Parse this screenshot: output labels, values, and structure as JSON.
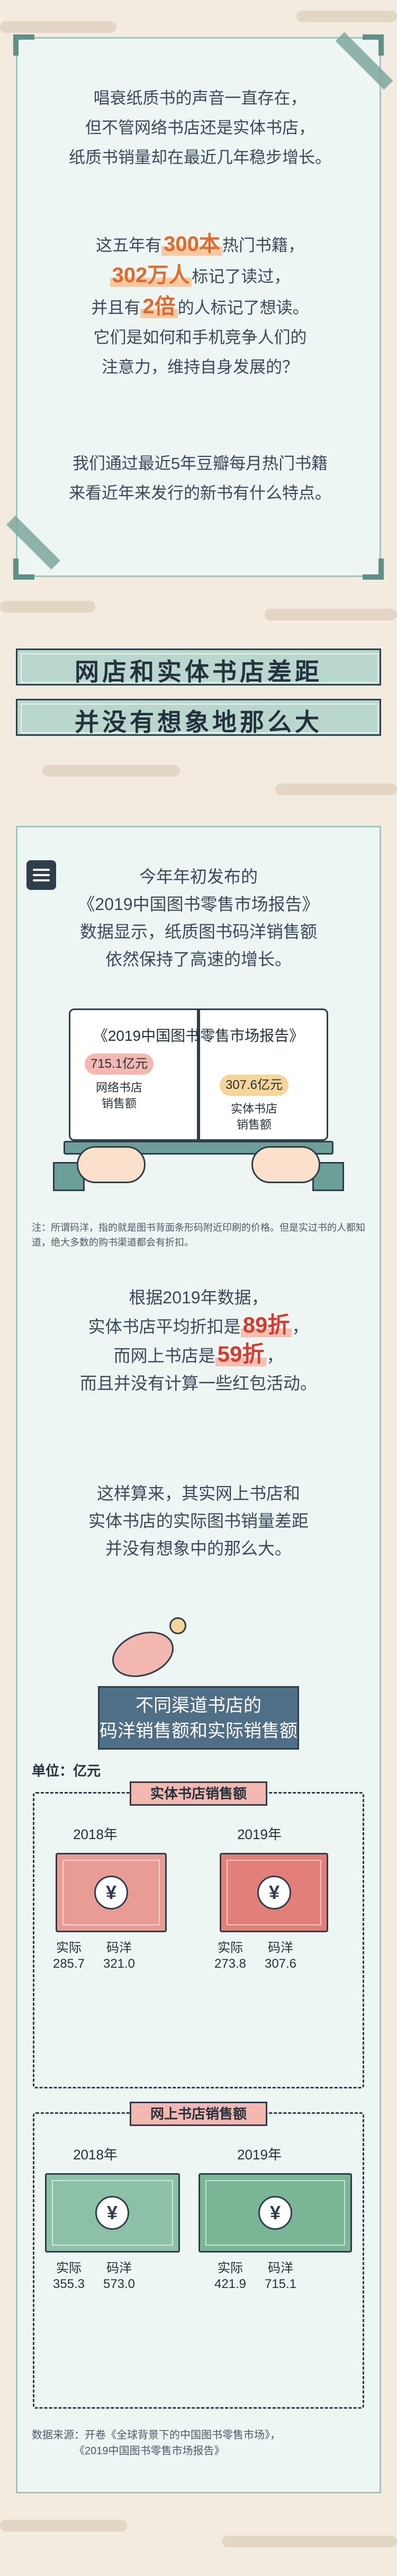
{
  "intro": {
    "line1": "唱衰纸质书的声音一直存在，",
    "line2": "但不管网络书店还是实体书店，",
    "line3": "纸质书销量却在最近几年稳步增长。",
    "stat1_pre": "这五年有",
    "stat1_hl": "300本",
    "stat1_post": "热门书籍，",
    "stat2_hl": "302万人",
    "stat2_post": "标记了读过，",
    "stat3_pre": "并且有",
    "stat3_hl": "2倍",
    "stat3_post": "的人标记了想读。",
    "q1": "它们是如何和手机竞争人们的",
    "q2": "注意力，维持自身发展的？",
    "p3_1": "我们通过最近5年豆瓣每月热门书籍",
    "p3_2": "来看近年来发行的新书有什么特点。"
  },
  "section_title": {
    "line1": "网店和实体书店差距",
    "line2": "并没有想象地那么大"
  },
  "report": {
    "l1": "今年年初发布的",
    "l2": "《2019中国图书零售市场报告》",
    "l3": "数据显示，纸质图书码洋销售额",
    "l4": "依然保持了高速的增长。",
    "book_title": "《2019中国图书零售市场报告》",
    "online_value": "715.1亿元",
    "online_label_1": "网络书店",
    "online_label_2": "销售额",
    "offline_value": "307.6亿元",
    "offline_label_1": "实体书店",
    "offline_label_2": "销售额"
  },
  "note": "注：所谓码洋，指的就是图书背面条形码附近印刷的价格。但是实过书的人都知道，绝大多数的购书渠道都会有折扣。",
  "discount": {
    "l1": "根据2019年数据，",
    "l2_pre": "实体书店平均折扣是",
    "l2_hl": "89折",
    "l2_post": "，",
    "l3_pre": "而网上书店是",
    "l3_hl": "59折",
    "l3_post": "，",
    "l4": "而且并没有计算一些红包活动。"
  },
  "conclusion": {
    "l1": "这样算来，其实网上书店和",
    "l2": "实体书店的实际图书销量差距",
    "l3": "并没有想象中的那么大。"
  },
  "banner": {
    "l1": "不同渠道书店的",
    "l2": "码洋销售额和实际销售额"
  },
  "unit": "单位：亿元",
  "offline_group": {
    "label": "实体书店销售额",
    "year_a": "2018年",
    "year_b": "2019年",
    "actual_label": "实际",
    "list_label": "码洋",
    "a_actual": "285.7",
    "a_list": "321.0",
    "b_actual": "273.8",
    "b_list": "307.6",
    "symbol": "¥"
  },
  "online_group": {
    "label": "网上书店销售额",
    "year_a": "2018年",
    "year_b": "2019年",
    "actual_label": "实际",
    "list_label": "码洋",
    "a_actual": "355.3",
    "a_list": "573.0",
    "b_actual": "421.9",
    "b_list": "715.1",
    "symbol": "¥"
  },
  "source": {
    "l1": "数据来源：开卷《全球背景下的中国图书零售市场》，",
    "l2": "《2019中国图书零售市场报告》"
  },
  "colors": {
    "accent_orange": "#e06a2c",
    "accent_red": "#d63c2e",
    "teal": "#6c9f97",
    "bill_red": "#e99b96",
    "bill_green": "#8cc1a7"
  }
}
